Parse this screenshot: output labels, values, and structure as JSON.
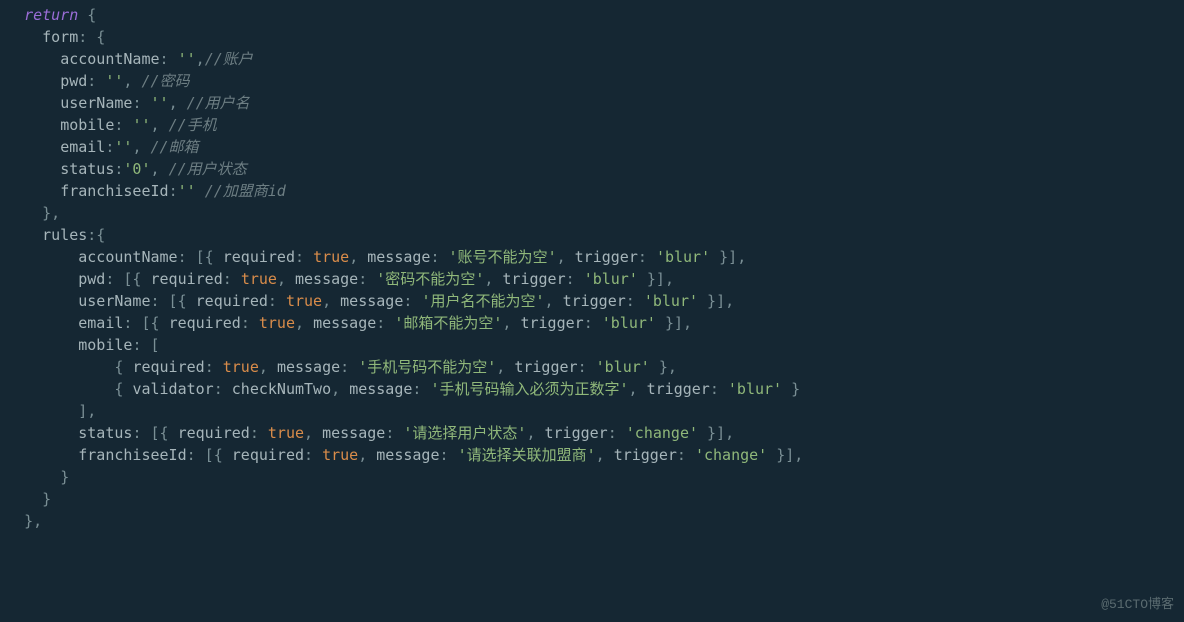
{
  "kw_return": "return",
  "form": {
    "name": "form",
    "fields": [
      {
        "key": "accountName",
        "value": "''",
        "comment": "//账户"
      },
      {
        "key": "pwd",
        "value": "''",
        "comment": "//密码",
        "spacePre": true
      },
      {
        "key": "userName",
        "value": "''",
        "comment": "//用户名",
        "spacePre": true
      },
      {
        "key": "mobile",
        "value": "''",
        "comment": "//手机",
        "spacePre": true
      },
      {
        "key": "email",
        "value": "''",
        "comment": "//邮箱"
      },
      {
        "key": "status",
        "value": "'0'",
        "comment": "//用户状态",
        "spacePre": true
      },
      {
        "key": "franchiseeId",
        "value": "''",
        "comment": "//加盟商id",
        "spaceOnly": true
      }
    ]
  },
  "rules": {
    "name": "rules",
    "simple": [
      {
        "key": "accountName",
        "msg": "'账号不能为空'",
        "trig": "'blur'"
      },
      {
        "key": "pwd",
        "msg": "'密码不能为空'",
        "trig": "'blur'"
      },
      {
        "key": "userName",
        "msg": "'用户名不能为空'",
        "trig": "'blur'"
      },
      {
        "key": "email",
        "msg": "'邮箱不能为空'",
        "trig": "'blur'"
      }
    ],
    "mobile": {
      "key": "mobile",
      "items": [
        {
          "label": "required",
          "val": "true",
          "msg": "'手机号码不能为空'",
          "trig": "'blur'",
          "comma": ","
        },
        {
          "label": "validator",
          "val": "checkNumTwo",
          "msg": "'手机号码输入必须为正数字'",
          "trig": "'blur'",
          "comma": ""
        }
      ]
    },
    "tail": [
      {
        "key": "status",
        "msg": "'请选择用户状态'",
        "trig": "'change'"
      },
      {
        "key": "franchiseeId",
        "msg": "'请选择关联加盟商'",
        "trig": "'change'"
      }
    ]
  },
  "labels": {
    "required": "required",
    "message": "message",
    "trigger": "trigger",
    "true": "true"
  },
  "watermark": "@51CTO博客"
}
